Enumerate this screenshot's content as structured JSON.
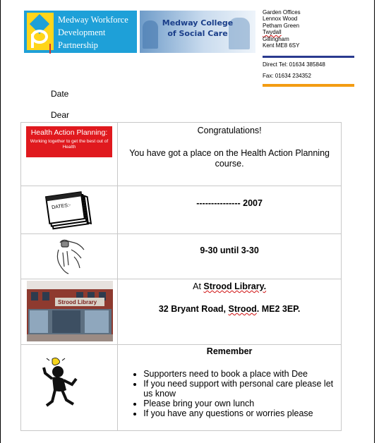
{
  "header": {
    "mwdp_logo_lines": [
      "Medway Workforce",
      "Development",
      "Partnership"
    ],
    "mcsc_logo_lines": [
      "Medway College",
      "of Social Care"
    ],
    "address_lines": [
      "Garden Offices",
      "Lennox Wood",
      "Petham Green",
      "Twydall",
      "Gillingham",
      "Kent ME8 6SY"
    ],
    "direct_tel": "Direct Tel: 01634 385848",
    "fax": "Fax: 01634 234352",
    "colors": {
      "blue_rule": "#2a3a8f",
      "orange_rule": "#f39c12",
      "mwdp_bg": "#1ea0d8",
      "mwdp_mark": "#ffd51a"
    }
  },
  "letter": {
    "date_label": "Date",
    "dear_label": "Dear"
  },
  "rows": {
    "course": {
      "badge_title": "Health Action Planning:",
      "badge_subtitle": "Working together to get the best out of Health",
      "congrats": "Congratulations!",
      "message": "You have got a place on the Health Action Planning course."
    },
    "date": {
      "calendar_label": "DATES:-",
      "value": "--------------- 2007"
    },
    "time": {
      "value": "9-30 until 3-30"
    },
    "venue": {
      "at_prefix": "At ",
      "library": "Strood Library.",
      "address_prefix": "32 Bryant Road, ",
      "town": "Strood",
      "address_suffix": ". ME2 3EP.",
      "sign_text": "Strood Library"
    },
    "remember": {
      "heading": "Remember",
      "items": [
        "Supporters need to book a place with Dee",
        "If you need support with personal care please let us know",
        "Please bring your own lunch",
        "If you have any questions or worries please"
      ]
    }
  }
}
